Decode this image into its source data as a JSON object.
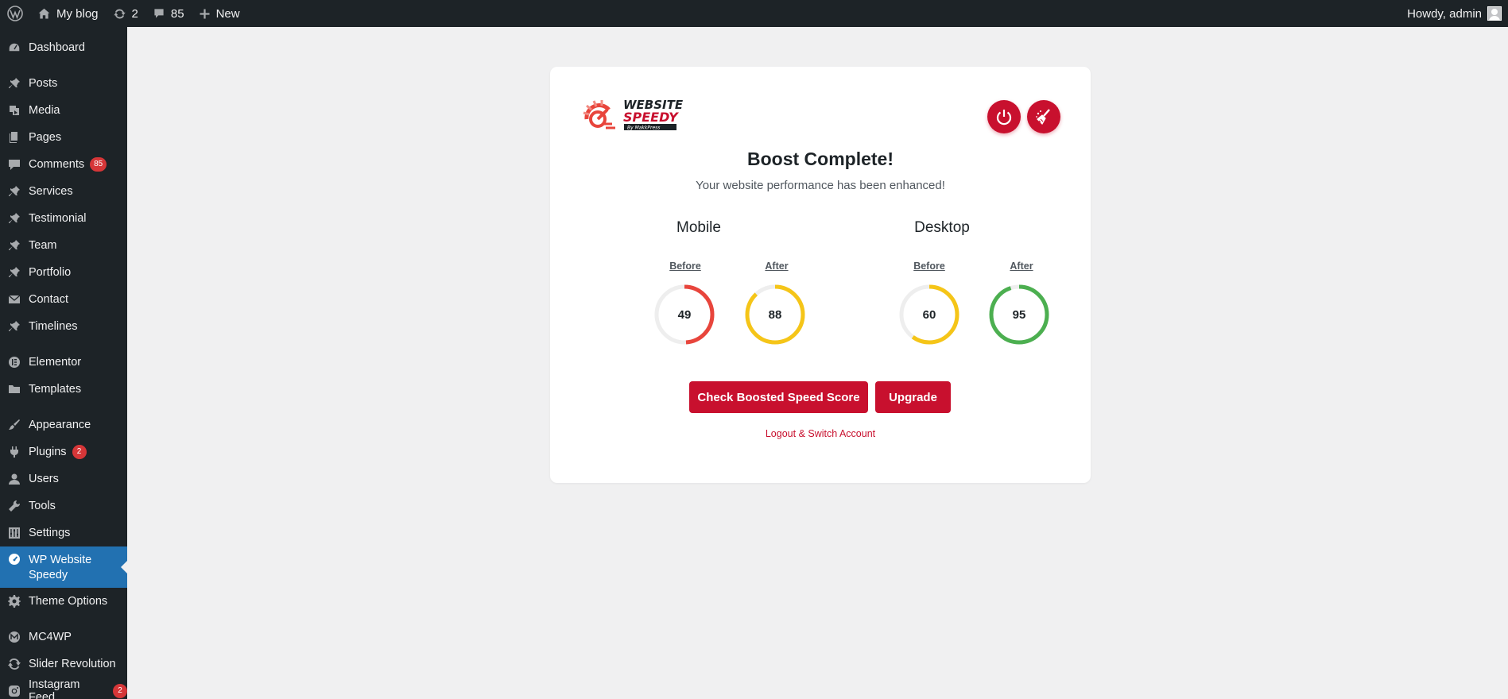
{
  "adminbar": {
    "site_name": "My blog",
    "updates_count": "2",
    "comments_count": "85",
    "new_label": "New",
    "howdy": "Howdy, admin"
  },
  "sidebar": {
    "items": [
      {
        "label": "Dashboard",
        "icon": "dashboard-icon"
      },
      {
        "label": "Posts",
        "icon": "pin-icon"
      },
      {
        "label": "Media",
        "icon": "media-icon"
      },
      {
        "label": "Pages",
        "icon": "pages-icon"
      },
      {
        "label": "Comments",
        "icon": "comment-icon",
        "badge": "85"
      },
      {
        "label": "Services",
        "icon": "pin-icon"
      },
      {
        "label": "Testimonial",
        "icon": "pin-icon"
      },
      {
        "label": "Team",
        "icon": "pin-icon"
      },
      {
        "label": "Portfolio",
        "icon": "pin-icon"
      },
      {
        "label": "Contact",
        "icon": "mail-icon"
      },
      {
        "label": "Timelines",
        "icon": "pin-icon"
      },
      {
        "label": "Elementor",
        "icon": "elementor-icon"
      },
      {
        "label": "Templates",
        "icon": "folder-icon"
      },
      {
        "label": "Appearance",
        "icon": "brush-icon"
      },
      {
        "label": "Plugins",
        "icon": "plug-icon",
        "badge": "2"
      },
      {
        "label": "Users",
        "icon": "user-icon"
      },
      {
        "label": "Tools",
        "icon": "wrench-icon"
      },
      {
        "label": "Settings",
        "icon": "settings-icon"
      },
      {
        "label": "WP Website Speedy",
        "icon": "gauge-icon",
        "active": true
      },
      {
        "label": "Theme Options",
        "icon": "gear-icon"
      },
      {
        "label": "MC4WP",
        "icon": "mc4wp-icon"
      },
      {
        "label": "Slider Revolution",
        "icon": "refresh-icon"
      },
      {
        "label": "Instagram Feed",
        "icon": "instagram-icon",
        "badge": "2"
      }
    ]
  },
  "card": {
    "logo_text_1": "WEBSITE",
    "logo_text_2": "SPEEDY",
    "logo_text_3": "By MakkPress",
    "title": "Boost Complete!",
    "subtitle": "Your website performance has been enhanced!",
    "mobile_label": "Mobile",
    "desktop_label": "Desktop",
    "before_label": "Before",
    "after_label": "After",
    "scores": {
      "mobile_before": {
        "value": "49",
        "color": "#e8453c"
      },
      "mobile_after": {
        "value": "88",
        "color": "#f5c518"
      },
      "desktop_before": {
        "value": "60",
        "color": "#f5c518"
      },
      "desktop_after": {
        "value": "95",
        "color": "#4caf50"
      }
    },
    "check_button": "Check Boosted Speed Score",
    "upgrade_button": "Upgrade",
    "logout_link": "Logout & Switch Account",
    "accent_color": "#c8102e"
  }
}
